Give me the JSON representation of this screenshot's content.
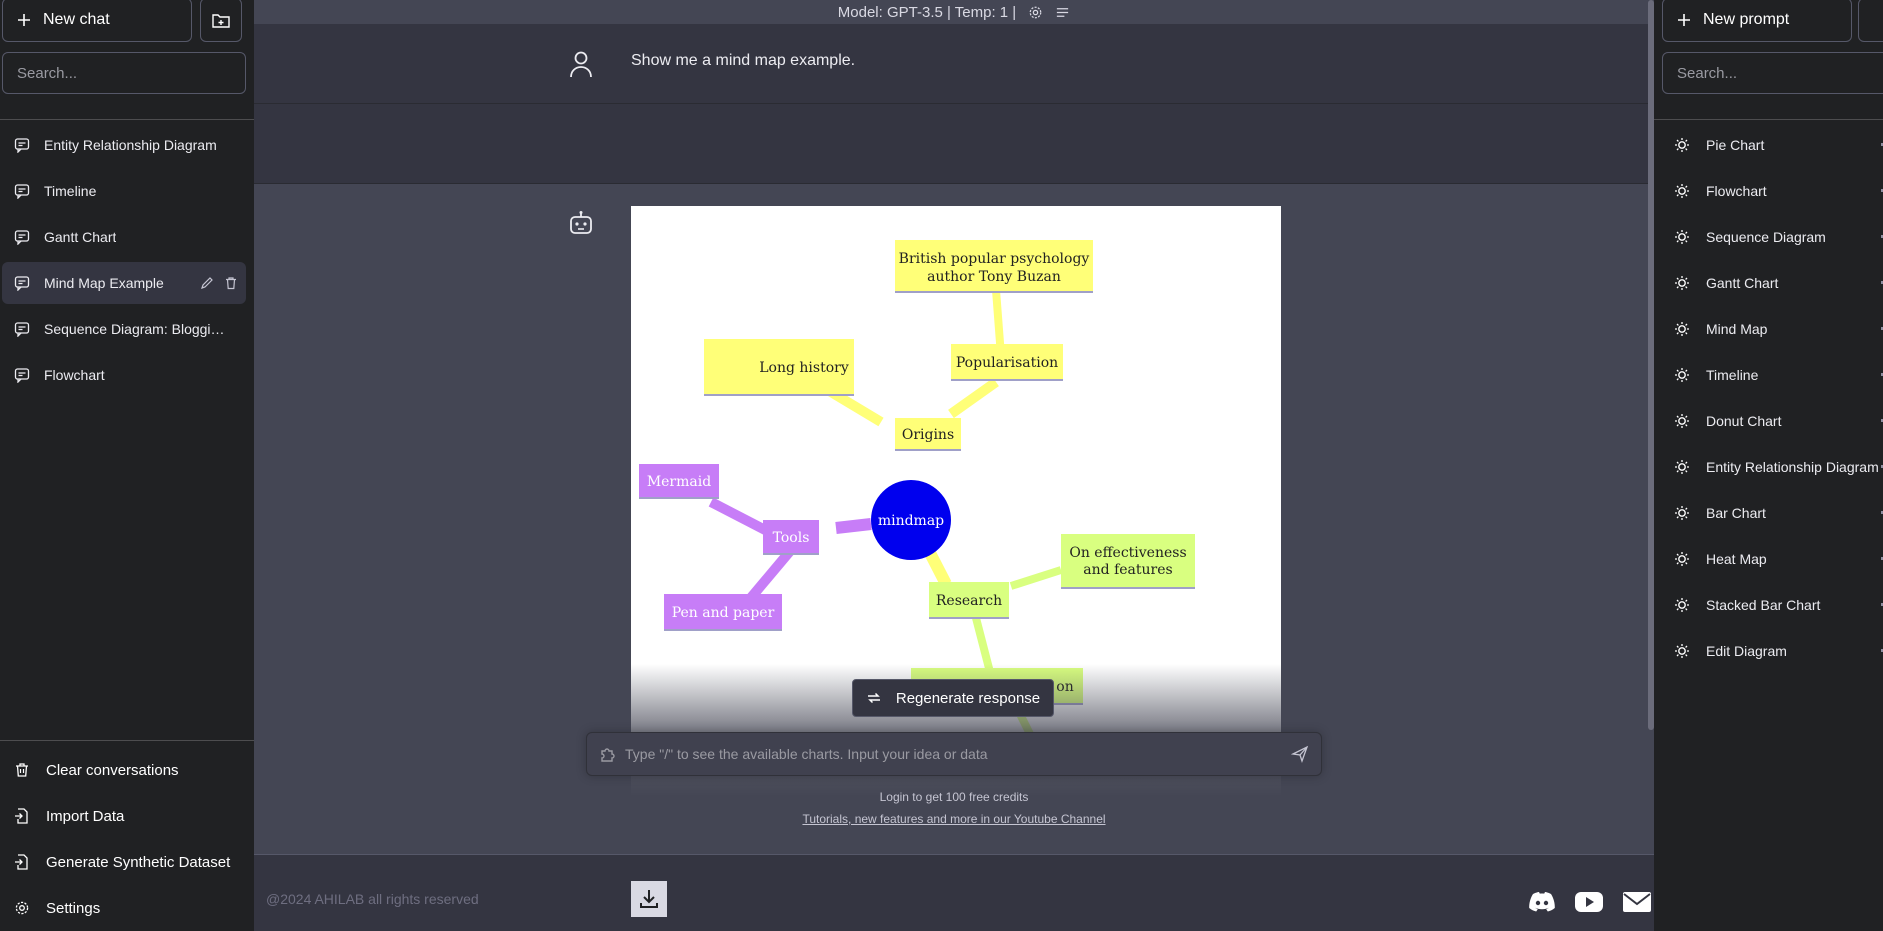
{
  "sidebar": {
    "new_chat": "New chat",
    "search_placeholder": "Search...",
    "conversations": [
      {
        "label": "Entity Relationship Diagram"
      },
      {
        "label": "Timeline"
      },
      {
        "label": "Gantt Chart"
      },
      {
        "label": "Mind Map Example"
      },
      {
        "label": "Sequence Diagram: Blogging ..."
      },
      {
        "label": "Flowchart"
      }
    ],
    "bottom": {
      "clear": "Clear conversations",
      "import": "Import Data",
      "synthetic": "Generate Synthetic Dataset",
      "settings": "Settings"
    }
  },
  "header": {
    "model_info": "Model: GPT-3.5 | Temp: 1 |"
  },
  "chat": {
    "user_message": "Show me a mind map example.",
    "mindmap": {
      "root": "mindmap",
      "origins": "Origins",
      "long_history": "Long history",
      "popularisation": "Popularisation",
      "buzan_line1": "British popular psychology",
      "buzan_line2": "author Tony Buzan",
      "research": "Research",
      "effectiveness_line1": "On effectiveness",
      "effectiveness_line2": "and features",
      "partial_hidden": "on",
      "tools": "Tools",
      "mermaid": "Mermaid",
      "pen_paper": "Pen and paper"
    },
    "regenerate": "Regenerate response",
    "input_placeholder": "Type \"/\" to see the available charts. Input your idea or data",
    "login_note": "Login to get 100 free credits",
    "tutorial_link": "Tutorials, new features and more in our Youtube Channel"
  },
  "footer": {
    "copyright": "@2024 AHILAB all rights reserved"
  },
  "prompts": {
    "new_prompt": "New prompt",
    "search_placeholder": "Search...",
    "items": [
      {
        "label": "Pie Chart"
      },
      {
        "label": "Flowchart"
      },
      {
        "label": "Sequence Diagram"
      },
      {
        "label": "Gantt Chart"
      },
      {
        "label": "Mind Map"
      },
      {
        "label": "Timeline"
      },
      {
        "label": "Donut Chart"
      },
      {
        "label": "Entity Relationship Diagram"
      },
      {
        "label": "Bar Chart"
      },
      {
        "label": "Heat Map"
      },
      {
        "label": "Stacked Bar Chart"
      },
      {
        "label": "Edit Diagram"
      }
    ]
  },
  "colors": {
    "origins_branch": "#ffff78",
    "tools_branch": "#c77df7",
    "research_branch": "#d9ff80",
    "root_node": "#0000ee"
  }
}
